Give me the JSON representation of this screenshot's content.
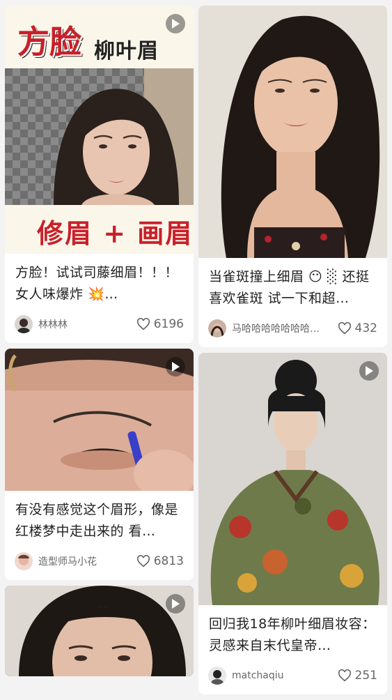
{
  "feed": {
    "posts": [
      {
        "title": "方脸！试试司藤细眉！！！女人味爆炸 💥…",
        "author": "林林林",
        "likes": "6196",
        "overlay_top_big": "方脸",
        "overlay_top_small": "柳叶眉",
        "overlay_bottom": "修眉 + 画眉",
        "is_video": true
      },
      {
        "title": "当雀斑撞上细眉 😶 ░ 还挺喜欢雀斑 试一下和超…",
        "author": "马哈哈哈哈哈哈哈…",
        "likes": "432",
        "is_video": false
      },
      {
        "title": "有没有感觉这个眉形，像是红楼梦中走出来的 看…",
        "author": "造型师马小花",
        "likes": "6813",
        "is_video": true
      },
      {
        "title": "回归我18年柳叶细眉妆容：灵感来自末代皇帝…",
        "author": "matchaqiu",
        "likes": "251",
        "is_video": true
      },
      {
        "is_video": true
      }
    ]
  },
  "colors": {
    "overlay_red": "#c8202a",
    "overlay_bg": "#fbf6ea",
    "muted_text": "#666666"
  }
}
